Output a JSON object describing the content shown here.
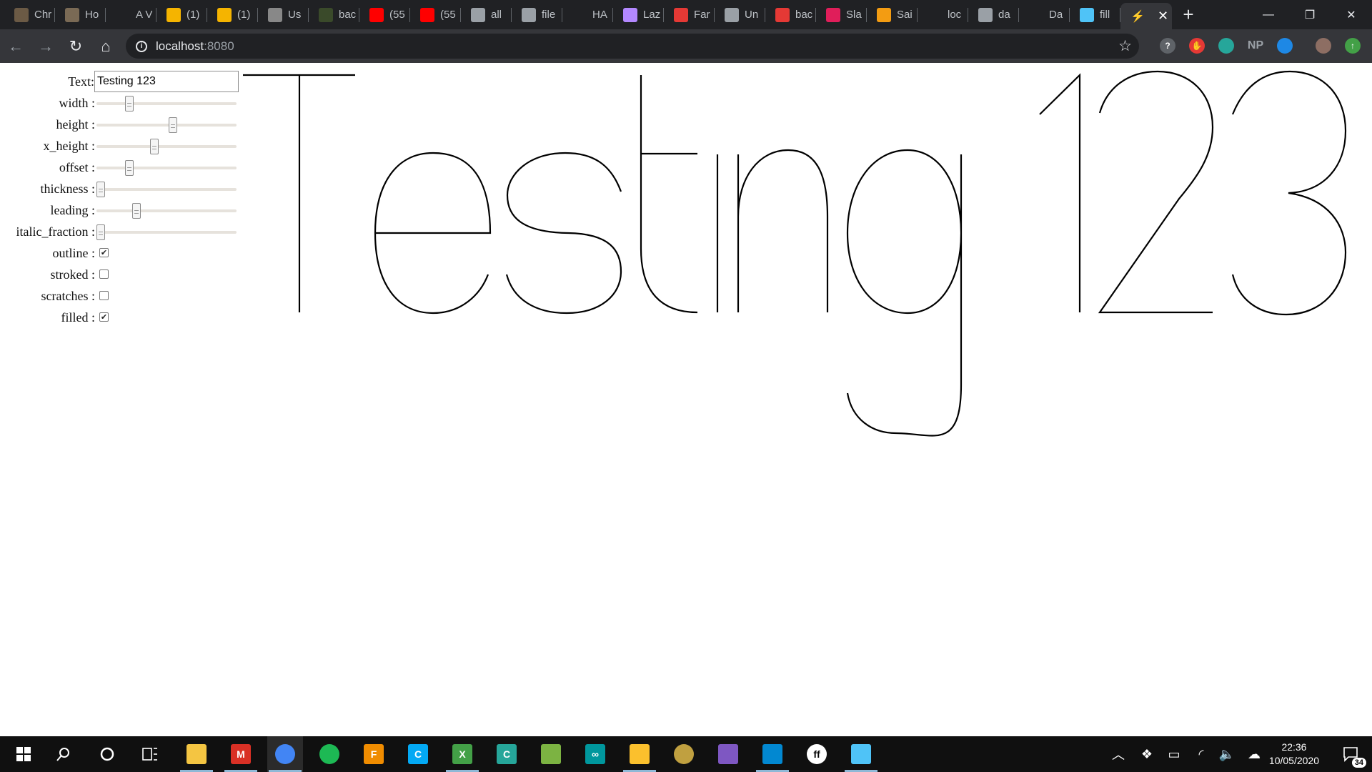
{
  "tabs": [
    {
      "title": "Chr",
      "favicon": "image-thumbnail-icon",
      "color": "#6b5a45"
    },
    {
      "title": "Ho",
      "favicon": "image-thumbnail-icon",
      "color": "#7a6a55"
    },
    {
      "title": "A V",
      "favicon": "globe-outline-icon",
      "color": "#202124"
    },
    {
      "title": "(1)",
      "favicon": "g-logo-icon",
      "color": "#f5b400"
    },
    {
      "title": "(1)",
      "favicon": "g-logo-icon",
      "color": "#f5b400"
    },
    {
      "title": "Us",
      "favicon": "portrait-icon",
      "color": "#888888"
    },
    {
      "title": "bac",
      "favicon": "chart-icon",
      "color": "#3a4a2a"
    },
    {
      "title": "(55",
      "favicon": "youtube-icon",
      "color": "#ff0000"
    },
    {
      "title": "(55",
      "favicon": "youtube-icon",
      "color": "#ff0000"
    },
    {
      "title": "all",
      "favicon": "globe-icon",
      "color": "#9aa0a6"
    },
    {
      "title": "file",
      "favicon": "globe-icon",
      "color": "#9aa0a6"
    },
    {
      "title": "HA",
      "favicon": "dots-icon",
      "color": "#202124"
    },
    {
      "title": "Laz",
      "favicon": "cursor-icon",
      "color": "#b388ff"
    },
    {
      "title": "Far",
      "favicon": "bookmark-icon",
      "color": "#e53935"
    },
    {
      "title": "Un",
      "favicon": "globe-icon",
      "color": "#9aa0a6"
    },
    {
      "title": "bac",
      "favicon": "doc-icon",
      "color": "#e53935"
    },
    {
      "title": "Sla",
      "favicon": "slack-icon",
      "color": "#e01e5a"
    },
    {
      "title": "Sai",
      "favicon": "s-icon",
      "color": "#f39c12"
    },
    {
      "title": "loc",
      "favicon": "bolt-icon",
      "color": "#202124"
    },
    {
      "title": "da",
      "favicon": "globe-icon",
      "color": "#9aa0a6"
    },
    {
      "title": "Da",
      "favicon": "bolt-icon",
      "color": "#202124"
    },
    {
      "title": "fill",
      "favicon": "cloud-icon",
      "color": "#4fc3f7"
    }
  ],
  "active_tab": {
    "favicon": "bolt-icon",
    "close": "✕"
  },
  "window_controls": {
    "minimize": "—",
    "restore": "❐",
    "close": "✕"
  },
  "address_bar": {
    "host": "localhost",
    "port": ":8080"
  },
  "extensions": [
    {
      "name": "help-extension-icon",
      "label": "?",
      "color": "#5f6368"
    },
    {
      "name": "adblock-extension-icon",
      "label": "✋",
      "color": "#e53935"
    },
    {
      "name": "shirt-extension-icon",
      "label": "",
      "color": "#26a69a"
    },
    {
      "name": "np-extension-icon",
      "label": "NP",
      "color": "#35363a"
    },
    {
      "name": "drop-extension-icon",
      "label": "",
      "color": "#1e88e5"
    },
    {
      "name": "profile-avatar",
      "label": "",
      "color": "#8d6e63"
    },
    {
      "name": "update-extension-icon",
      "label": "↑",
      "color": "#43a047"
    }
  ],
  "controls": {
    "text_label": "Text:",
    "text_value": "Testing 123",
    "sliders": [
      {
        "label": "width :",
        "value": 0.22
      },
      {
        "label": "height :",
        "value": 0.55
      },
      {
        "label": "x_height :",
        "value": 0.41
      },
      {
        "label": "offset :",
        "value": 0.22
      },
      {
        "label": "thickness :",
        "value": 0.0
      },
      {
        "label": "leading :",
        "value": 0.27
      },
      {
        "label": "italic_fraction :",
        "value": 0.0
      }
    ],
    "checkboxes": [
      {
        "label": "outline :",
        "checked": true
      },
      {
        "label": "stroked :",
        "checked": false
      },
      {
        "label": "scratches :",
        "checked": false
      },
      {
        "label": "filled :",
        "checked": true
      }
    ]
  },
  "taskbar": {
    "apps": [
      {
        "name": "file-explorer-icon",
        "color": "#f4c542",
        "label": "",
        "running": true
      },
      {
        "name": "gmail-icon",
        "color": "#d93025",
        "label": "M",
        "running": true
      },
      {
        "name": "chrome-icon",
        "color": "#4285f4",
        "label": "",
        "running": true,
        "current": true
      },
      {
        "name": "spotify-icon",
        "color": "#1db954",
        "label": "",
        "running": false
      },
      {
        "name": "fontlab-icon",
        "color": "#f08c00",
        "label": "F",
        "running": false
      },
      {
        "name": "c-app-icon",
        "color": "#03a9f4",
        "label": "C",
        "running": false
      },
      {
        "name": "x-app-icon",
        "color": "#43a047",
        "label": "X",
        "running": true
      },
      {
        "name": "terminal-app-icon",
        "color": "#26a69a",
        "label": "C",
        "running": false
      },
      {
        "name": "image-viewer-icon",
        "color": "#7cb342",
        "label": "",
        "running": false
      },
      {
        "name": "arduino-icon",
        "color": "#00979d",
        "label": "∞",
        "running": false
      },
      {
        "name": "idea-bulb-icon",
        "color": "#fbc02d",
        "label": "",
        "running": true
      },
      {
        "name": "globe-app-icon",
        "color": "#c0a040",
        "label": "",
        "running": false
      },
      {
        "name": "visual-studio-icon",
        "color": "#7e57c2",
        "label": "",
        "running": false
      },
      {
        "name": "vscode-icon",
        "color": "#0288d1",
        "label": "",
        "running": true
      },
      {
        "name": "ff-app-icon",
        "color": "#ffffff",
        "label": "ff",
        "running": false
      },
      {
        "name": "paint-app-icon",
        "color": "#4fc3f7",
        "label": "",
        "running": true
      }
    ],
    "clock": {
      "time": "22:36",
      "date": "10/05/2020"
    },
    "notifications": "34"
  }
}
